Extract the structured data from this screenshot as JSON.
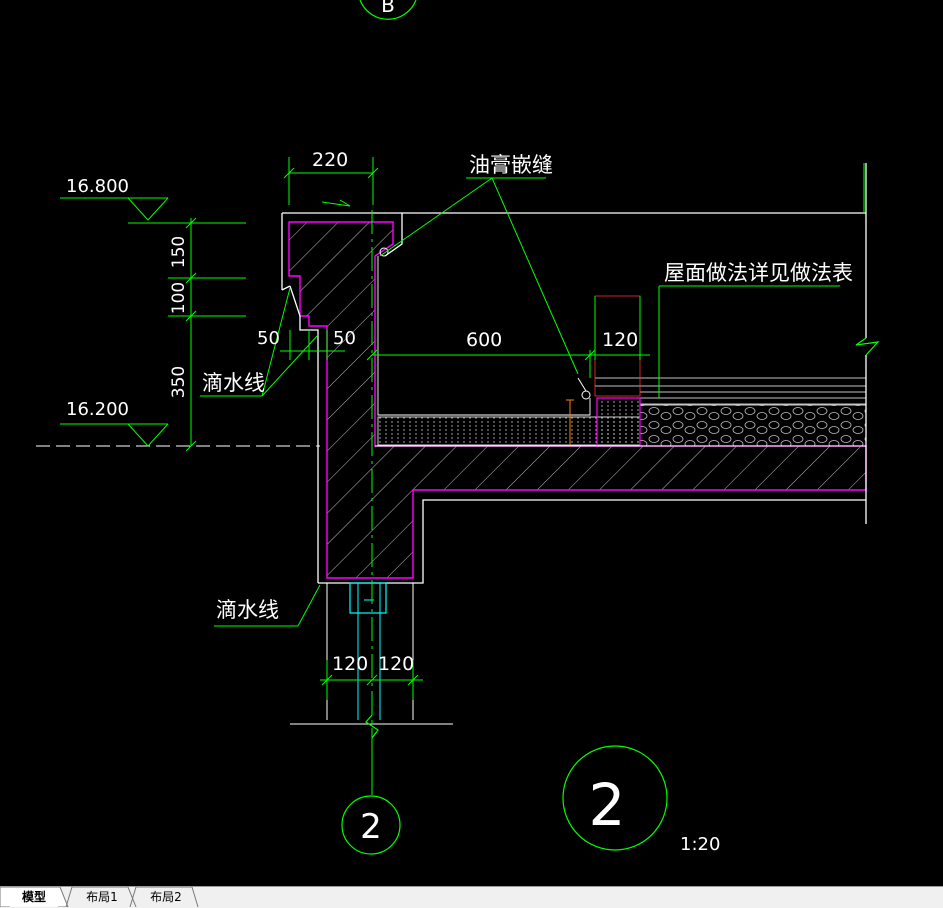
{
  "drawing": {
    "level_top": "16.800",
    "level_bottom": "16.200",
    "dim_width_top": "220",
    "dim_150": "150",
    "dim_100": "100",
    "dim_350": "350",
    "dim_50_left": "50",
    "dim_50_right": "50",
    "dim_600": "600",
    "dim_120_top": "120",
    "dim_120_bot_left": "120",
    "dim_120_bot_right": "120",
    "label_sealant": "油膏嵌缝",
    "label_roof_note": "屋面做法详见做法表",
    "label_drip_upper": "滴水线",
    "label_drip_lower": "滴水线",
    "axis_label_bottom": "2",
    "axis_label_top": "B",
    "detail_number": "2",
    "detail_scale": "1:20"
  },
  "tabs": [
    "模型",
    "布局1",
    "布局2"
  ],
  "colors": {
    "background": "#000000",
    "outline": "#ffffff",
    "dimension": "#00ff00",
    "concrete_edge": "#ff00ff",
    "hatch": "#cfcfcf",
    "orange": "#ff8000",
    "red": "#ff3030",
    "cyan": "#00ffff"
  }
}
